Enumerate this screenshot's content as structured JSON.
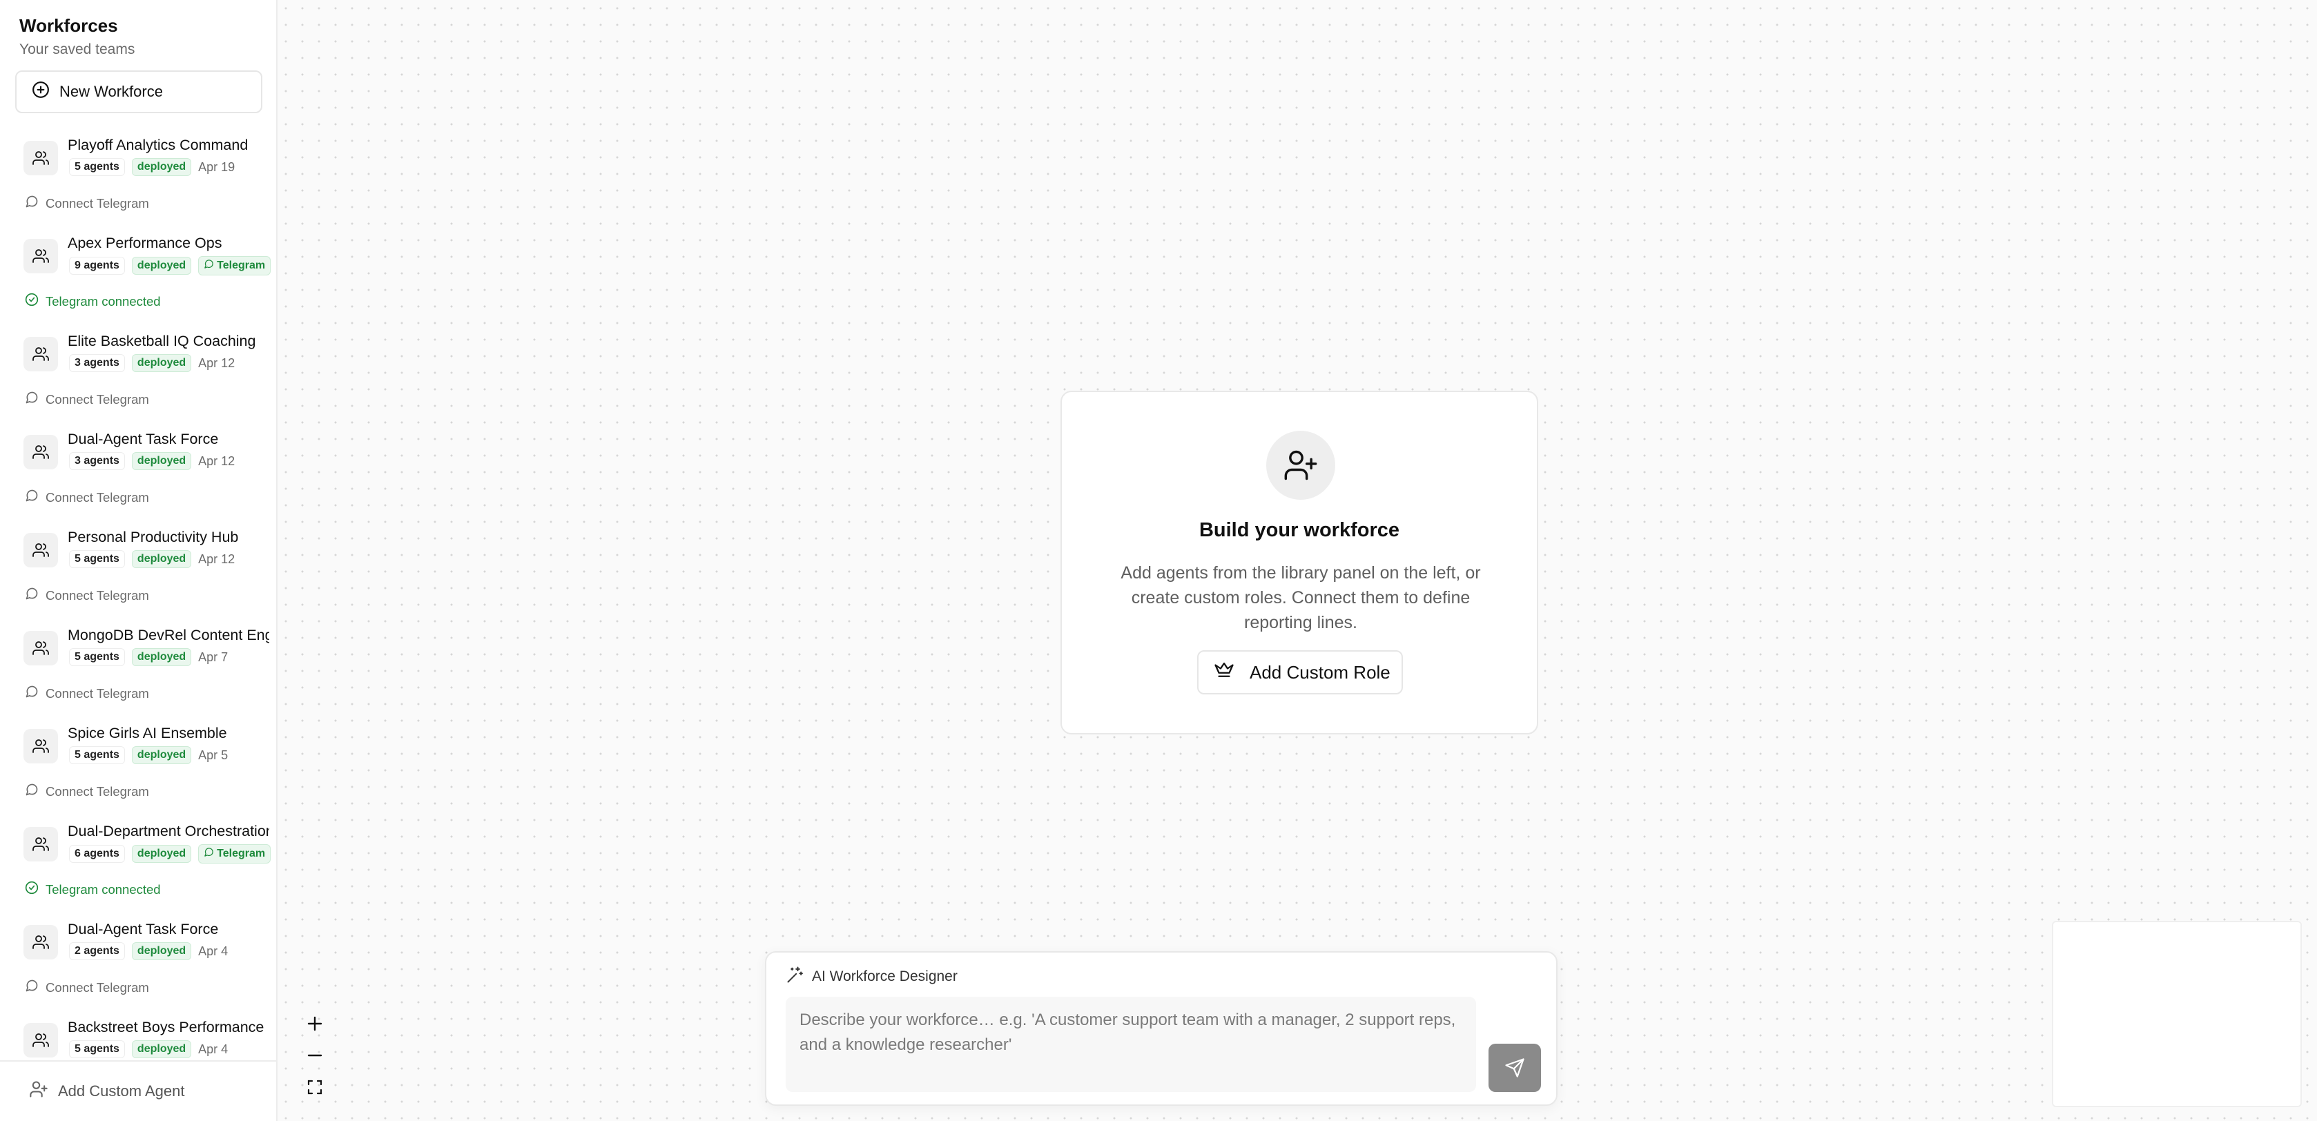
{
  "sidebar": {
    "title": "Workforces",
    "subtitle": "Your saved teams",
    "new_button_label": "New Workforce",
    "footer_label": "Add Custom Agent",
    "workforces": [
      {
        "name": "Playoff Analytics Command",
        "agents": "5 agents",
        "status": "deployed",
        "date": "Apr 19",
        "telegram_badge": "",
        "telegram_text": "Connect Telegram",
        "telegram_connected": false
      },
      {
        "name": "Apex Performance Ops",
        "agents": "9 agents",
        "status": "deployed",
        "date": "",
        "telegram_badge": "Telegram",
        "telegram_text": "Telegram connected",
        "telegram_connected": true
      },
      {
        "name": "Elite Basketball IQ Coaching",
        "agents": "3 agents",
        "status": "deployed",
        "date": "Apr 12",
        "telegram_badge": "",
        "telegram_text": "Connect Telegram",
        "telegram_connected": false
      },
      {
        "name": "Dual-Agent Task Force",
        "agents": "3 agents",
        "status": "deployed",
        "date": "Apr 12",
        "telegram_badge": "",
        "telegram_text": "Connect Telegram",
        "telegram_connected": false
      },
      {
        "name": "Personal Productivity Hub",
        "agents": "5 agents",
        "status": "deployed",
        "date": "Apr 12",
        "telegram_badge": "",
        "telegram_text": "Connect Telegram",
        "telegram_connected": false
      },
      {
        "name": "MongoDB DevRel Content Engine",
        "agents": "5 agents",
        "status": "deployed",
        "date": "Apr 7",
        "telegram_badge": "",
        "telegram_text": "Connect Telegram",
        "telegram_connected": false
      },
      {
        "name": "Spice Girls AI Ensemble",
        "agents": "5 agents",
        "status": "deployed",
        "date": "Apr 5",
        "telegram_badge": "",
        "telegram_text": "Connect Telegram",
        "telegram_connected": false
      },
      {
        "name": "Dual-Department Orchestration",
        "agents": "6 agents",
        "status": "deployed",
        "date": "",
        "telegram_badge": "Telegram",
        "telegram_text": "Telegram connected",
        "telegram_connected": true
      },
      {
        "name": "Dual-Agent Task Force",
        "agents": "2 agents",
        "status": "deployed",
        "date": "Apr 4",
        "telegram_badge": "",
        "telegram_text": "Connect Telegram",
        "telegram_connected": false
      },
      {
        "name": "Backstreet Boys Performance",
        "agents": "5 agents",
        "status": "deployed",
        "date": "Apr 4",
        "telegram_badge": "",
        "telegram_text": "",
        "telegram_connected": false
      }
    ]
  },
  "empty_state": {
    "title": "Build your workforce",
    "description": "Add agents from the library panel on the left, or create custom roles. Connect them to define reporting lines.",
    "button_label": "Add Custom Role"
  },
  "designer": {
    "title": "AI Workforce Designer",
    "placeholder": "Describe your workforce… e.g. 'A customer support team with a manager, 2 support reps, and a knowledge researcher'",
    "value": ""
  },
  "zoom_controls": {
    "zoom_in": "+",
    "zoom_out": "−"
  },
  "colors": {
    "accent_green": "#1e8a3c",
    "send_button": "#8a8a8a",
    "canvas_dot": "#d6d6d6"
  },
  "icons": {
    "workforce": "users-icon",
    "new": "plus-circle-icon",
    "telegram": "message-circle-icon",
    "connected": "check-circle-icon",
    "build": "user-plus-icon",
    "custom_role": "crown-icon",
    "designer": "sparkles-icon",
    "send": "send-icon",
    "fit": "fullscreen-icon"
  }
}
